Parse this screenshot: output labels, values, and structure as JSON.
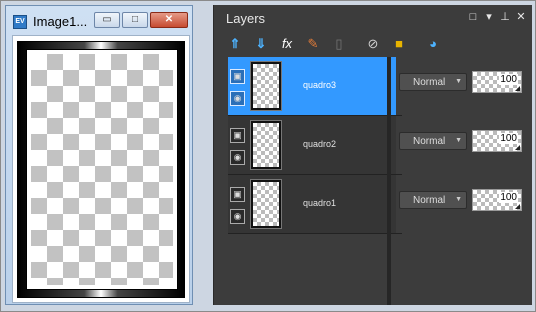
{
  "image_window": {
    "title": "Image1...",
    "app_icon_text": "EV",
    "min_glyph": "▭",
    "max_glyph": "□",
    "close_glyph": "✕"
  },
  "layers_panel": {
    "title": "Layers",
    "controls": {
      "dock": "□",
      "menu": "▾",
      "pin": "⊥",
      "close": "✕"
    },
    "toolbar_icons": [
      "new-raster-layer-icon",
      "new-vector-layer-icon",
      "layer-style-icon",
      "adjustment-layer-icon",
      "delete-layer-icon",
      "link-layers-icon",
      "lock-layer-icon",
      "mask-icon"
    ],
    "layers": [
      {
        "name": "quadro3",
        "selected": true,
        "blend_mode": "Normal",
        "opacity": "100"
      },
      {
        "name": "quadro2",
        "selected": false,
        "blend_mode": "Normal",
        "opacity": "100"
      },
      {
        "name": "quadro1",
        "selected": false,
        "blend_mode": "Normal",
        "opacity": "100"
      }
    ]
  },
  "colors": {
    "selection": "#3399ff",
    "panel_bg": "#3c3c3c"
  }
}
